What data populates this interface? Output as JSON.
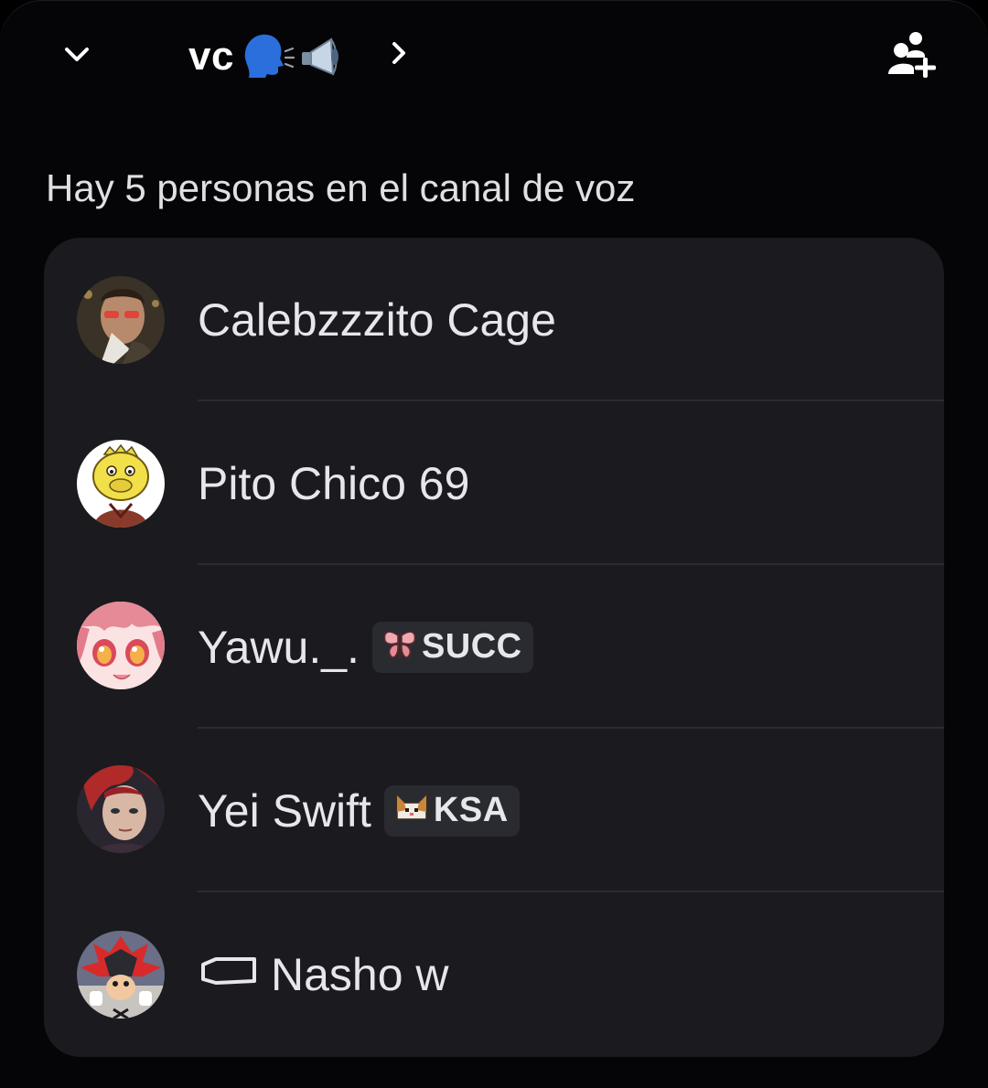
{
  "header": {
    "channel_name": "vc",
    "channel_emoji_1": "🗣️",
    "channel_emoji_2": "🔈",
    "collapse_icon": "chevron-down-icon",
    "open_icon": "chevron-right-icon",
    "invite_icon": "add-people-icon"
  },
  "voice": {
    "count_text": "Hay 5 personas en el canal de voz",
    "members": [
      {
        "name": "Calebzzzito Cage",
        "tag": null,
        "avatar": "photo-avatar"
      },
      {
        "name": "Pito Chico 69",
        "tag": null,
        "avatar": "yellow-cartoon-avatar"
      },
      {
        "name": "Yawu._.",
        "tag": "SUCC",
        "tag_icon": "butterfly-icon",
        "avatar": "anime-avatar"
      },
      {
        "name": "Yei Swift",
        "tag": "KSA",
        "tag_icon": "cat-icon",
        "avatar": "red-hair-avatar"
      },
      {
        "name": "Nasho w",
        "tag": null,
        "prefix_icon": "capsule-icon",
        "avatar": "hedgehog-avatar"
      }
    ]
  },
  "colors": {
    "background": "#050507",
    "card": "#1a1a1f",
    "tag_bg": "#2a2b31",
    "text": "#e6e7ea"
  }
}
